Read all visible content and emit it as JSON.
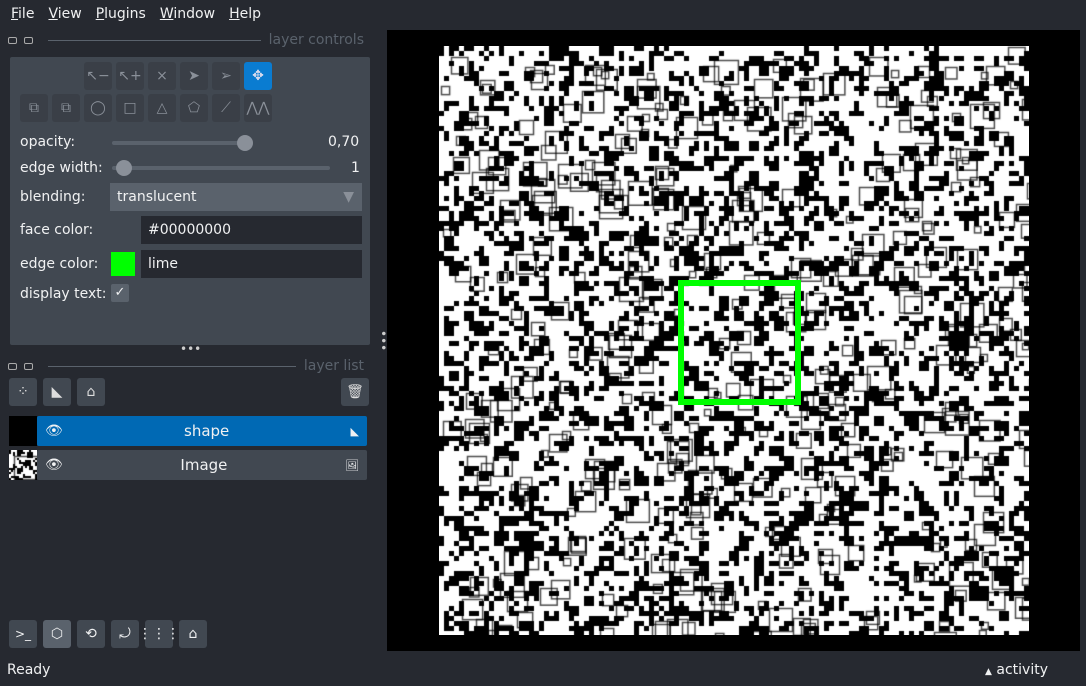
{
  "menu": [
    "File",
    "View",
    "Plugins",
    "Window",
    "Help"
  ],
  "layer_controls": {
    "title": "layer controls",
    "opacity_label": "opacity:",
    "opacity_value": "0,70",
    "opacity": 0.7,
    "edge_width_label": "edge width:",
    "edge_width_value": "1",
    "blending_label": "blending:",
    "blending_value": "translucent",
    "face_color_label": "face color:",
    "face_color_value": "#00000000",
    "edge_color_label": "edge color:",
    "edge_color_value": "lime",
    "edge_color": "#00ff00",
    "display_text_label": "display text:",
    "display_text_checked": true
  },
  "layer_list": {
    "title": "layer list",
    "layers": [
      {
        "name": "shape",
        "selected": true,
        "type": "shapes"
      },
      {
        "name": "Image",
        "selected": false,
        "type": "image"
      }
    ]
  },
  "status": "Ready",
  "activity": "activity",
  "colors": {
    "accent": "#0a7cd1",
    "selected_layer": "#0069b4",
    "shape_edge": "#00ff00"
  }
}
